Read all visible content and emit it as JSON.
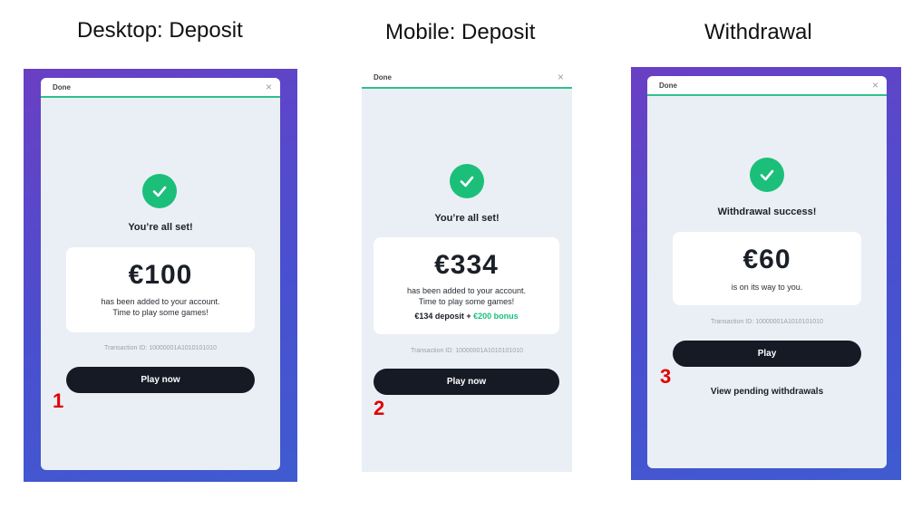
{
  "columns": [
    {
      "title": "Desktop: Deposit",
      "top_label": "Done",
      "close_icon": "×",
      "headline": "You’re all set!",
      "amount": "€100",
      "desc_line1": "has been added to your account.",
      "desc_line2": "Time to play some games!",
      "transaction": "Transaction ID: 10000001A1010101010",
      "button": "Play now",
      "marker": "1"
    },
    {
      "title": "Mobile: Deposit",
      "top_label": "Done",
      "close_icon": "×",
      "headline": "You’re all set!",
      "amount": "€334",
      "desc_line1": "has been added to your account.",
      "desc_line2": "Time to play some games!",
      "bonus_deposit": "€134 deposit + ",
      "bonus_amount": "€200 bonus",
      "transaction": "Transaction ID: 10000001A1010101010",
      "button": "Play now",
      "marker": "2"
    },
    {
      "title": "Withdrawal",
      "top_label": "Done",
      "close_icon": "×",
      "headline": "Withdrawal success!",
      "amount": "€60",
      "desc_line1": "is on its way to you.",
      "transaction": "Transaction ID: 10000001A1010101010",
      "button": "Play",
      "link": "View pending withdrawals",
      "marker": "3"
    }
  ],
  "colors": {
    "accent_green": "#1bbf7a",
    "button_dark": "#151a24",
    "card_bg": "#eaeff5",
    "marker_red": "#e00000"
  }
}
